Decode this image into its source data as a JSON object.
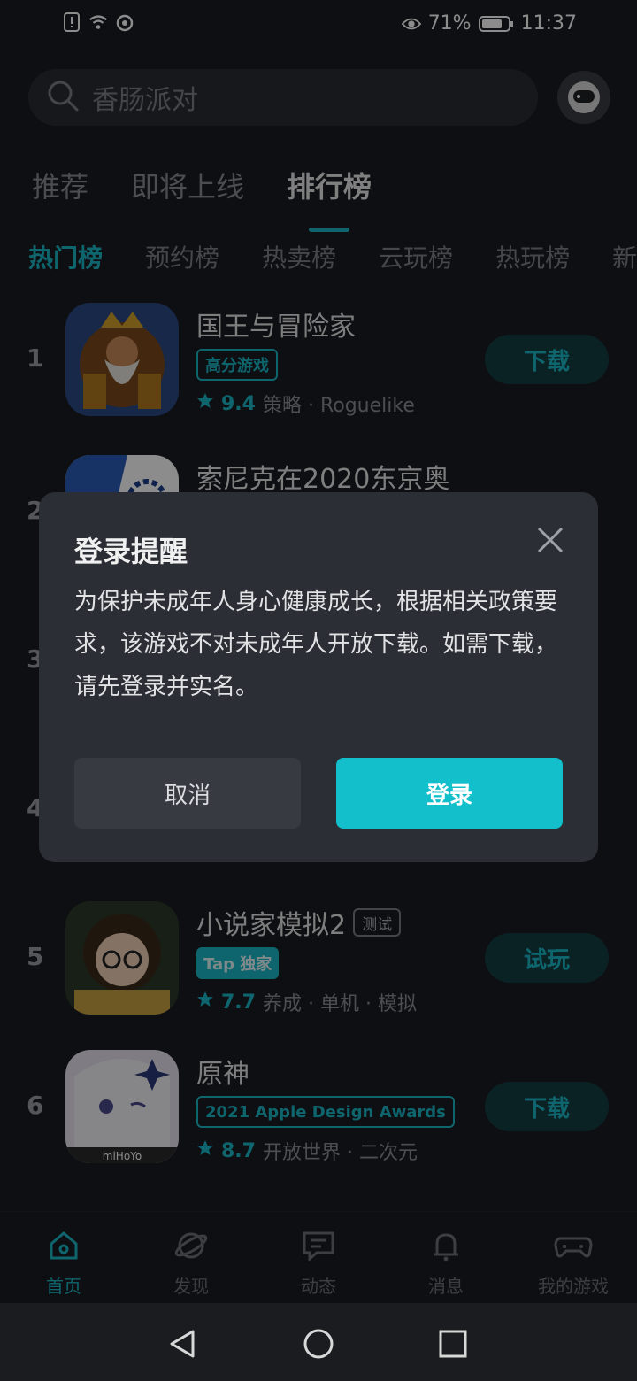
{
  "status": {
    "battery": "71%",
    "time": "11:37"
  },
  "search": {
    "placeholder": "香肠派对"
  },
  "tabs": [
    {
      "label": "推荐"
    },
    {
      "label": "即将上线"
    },
    {
      "label": "排行榜"
    }
  ],
  "subtabs": [
    {
      "label": "热门榜"
    },
    {
      "label": "预约榜"
    },
    {
      "label": "热卖榜"
    },
    {
      "label": "云玩榜"
    },
    {
      "label": "热玩榜"
    },
    {
      "label": "新"
    }
  ],
  "list": [
    {
      "rank": "1",
      "title": "国王与冒险家",
      "tag": "高分游戏",
      "rating": "9.4",
      "meta": "策略 · Roguelike",
      "action": "下载"
    },
    {
      "rank": "2",
      "title": "索尼克在2020东京奥"
    },
    {
      "rank": "3"
    },
    {
      "rank": "4"
    },
    {
      "rank": "5",
      "title": "小说家模拟2",
      "test": "测试",
      "tag": "Tap 独家",
      "rating": "7.7",
      "meta": "养成 · 单机 · 模拟",
      "action": "试玩"
    },
    {
      "rank": "6",
      "title": "原神",
      "tag": "2021 Apple Design Awards",
      "rating": "8.7",
      "meta": "开放世界 · 二次元",
      "action": "下载",
      "icon_text": "miHoYo"
    }
  ],
  "dialog": {
    "title": "登录提醒",
    "message": "为保护未成年人身心健康成长，根据相关政策要求，该游戏不对未成年人开放下载。如需下载，请先登录并实名。",
    "cancel": "取消",
    "confirm": "登录"
  },
  "bottom_nav": [
    {
      "label": "首页",
      "icon": "home-icon"
    },
    {
      "label": "发现",
      "icon": "planet-icon"
    },
    {
      "label": "动态",
      "icon": "chat-icon"
    },
    {
      "label": "消息",
      "icon": "bell-icon"
    },
    {
      "label": "我的游戏",
      "icon": "gamepad-icon"
    }
  ],
  "colors": {
    "accent": "#1cb8c6",
    "background": "#1b1d22",
    "dialog": "#2b2e35"
  }
}
